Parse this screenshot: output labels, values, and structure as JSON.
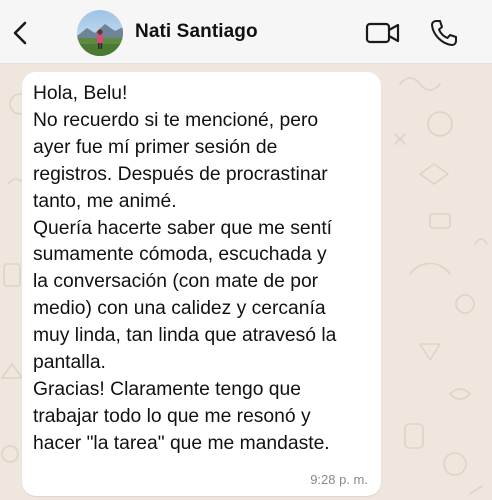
{
  "header": {
    "contact_name": "Nati Santiago",
    "icons": {
      "back": "chevron-left-icon",
      "video": "video-camera-icon",
      "call": "phone-icon"
    }
  },
  "message": {
    "text": "Hola, Belu!\nNo recuerdo si te mencioné, pero\nayer fue mí primer sesión de\nregistros. Después de procrastinar\ntanto, me animé.\nQuería hacerte saber que me sentí\nsumamente cómoda, escuchada y\nla conversación (con mate de por\nmedio) con una calidez y cercanía\nmuy linda, tan linda que atravesó la\npantalla.\nGracias! Claramente tengo que\ntrabajar todo lo que me resonó y\nhacer \"la tarea\" que me mandaste.",
    "time": "9:28 p. m."
  },
  "colors": {
    "header_bg": "#f6f6f6",
    "chat_bg": "#efe7dd",
    "bubble_bg": "#ffffff",
    "text": "#111111",
    "timestamp": "#8a8a8a"
  }
}
